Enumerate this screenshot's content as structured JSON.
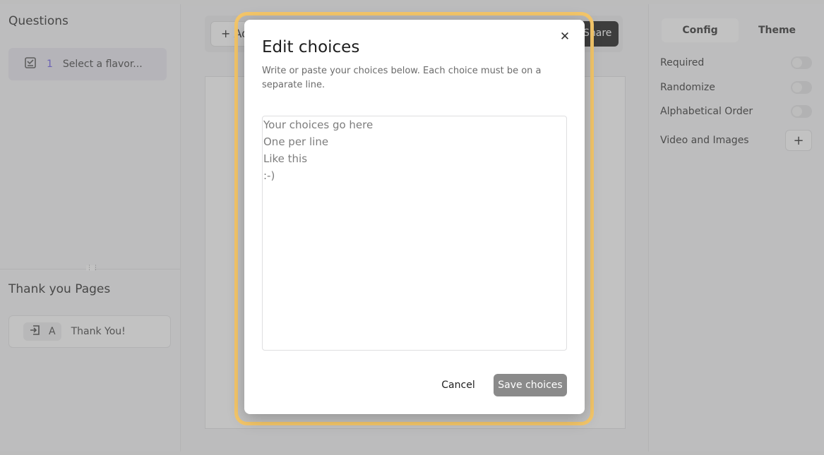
{
  "left_panel": {
    "questions_heading": "Questions",
    "question": {
      "number": "1",
      "label": "Select a flavor..."
    },
    "thankyou_heading": "Thank you Pages",
    "thankyou_item": {
      "letter": "A",
      "label": "Thank You!"
    }
  },
  "center": {
    "add_label": "Ad",
    "share_label": "Share"
  },
  "right_panel": {
    "tabs": [
      "Config",
      "Theme"
    ],
    "settings": {
      "required": "Required",
      "randomize": "Randomize",
      "alphabetical": "Alphabetical Order",
      "media": "Video and Images"
    }
  },
  "modal": {
    "title": "Edit choices",
    "description": "Write or paste your choices below. Each choice must be on a separate line.",
    "placeholder": "Your choices go here\nOne per line\nLike this\n:-)",
    "cancel_label": "Cancel",
    "save_label": "Save choices",
    "save_color": "#8a8a8a",
    "highlight_color": "#f5c76a"
  }
}
